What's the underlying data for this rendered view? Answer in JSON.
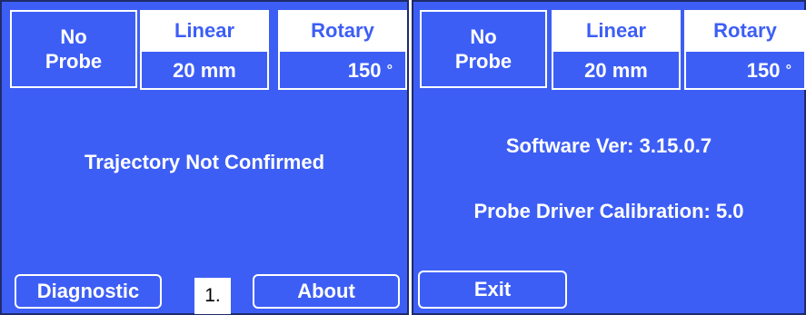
{
  "left_panel": {
    "status": {
      "probe_line1": "No",
      "probe_line2": "Probe",
      "linear_label": "Linear",
      "linear_value": "20 mm",
      "rotary_label": "Rotary",
      "rotary_value": "150",
      "rotary_unit": "°"
    },
    "message": "Trajectory Not Confirmed",
    "diagnostic_button": "Diagnostic",
    "about_button": "About"
  },
  "callout_label": "1.",
  "right_panel": {
    "status": {
      "probe_line1": "No",
      "probe_line2": "Probe",
      "linear_label": "Linear",
      "linear_value": "20 mm",
      "rotary_label": "Rotary",
      "rotary_value": "150",
      "rotary_unit": "°"
    },
    "software_version": "Software Ver: 3.15.0.7",
    "calibration": "Probe Driver Calibration: 5.0",
    "exit_button": "Exit"
  },
  "colors": {
    "panel_bg": "#3d5ef5",
    "border": "#1f2a6b",
    "text": "#ffffff"
  }
}
